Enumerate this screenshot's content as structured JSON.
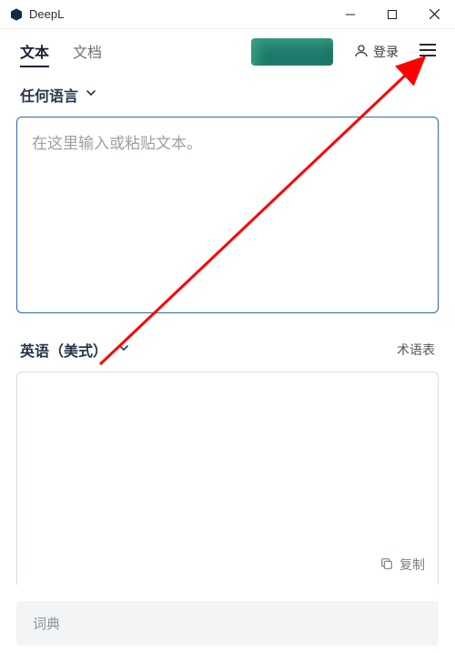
{
  "app": {
    "title": "DeepL"
  },
  "tabs": {
    "text": "文本",
    "document": "文档"
  },
  "login_label": "登录",
  "source": {
    "lang": "任何语言",
    "placeholder": "在这里输入或粘贴文本。"
  },
  "target": {
    "lang": "英语（美式）",
    "glossary": "术语表"
  },
  "copy_label": "复制",
  "dictionary_label": "词典"
}
